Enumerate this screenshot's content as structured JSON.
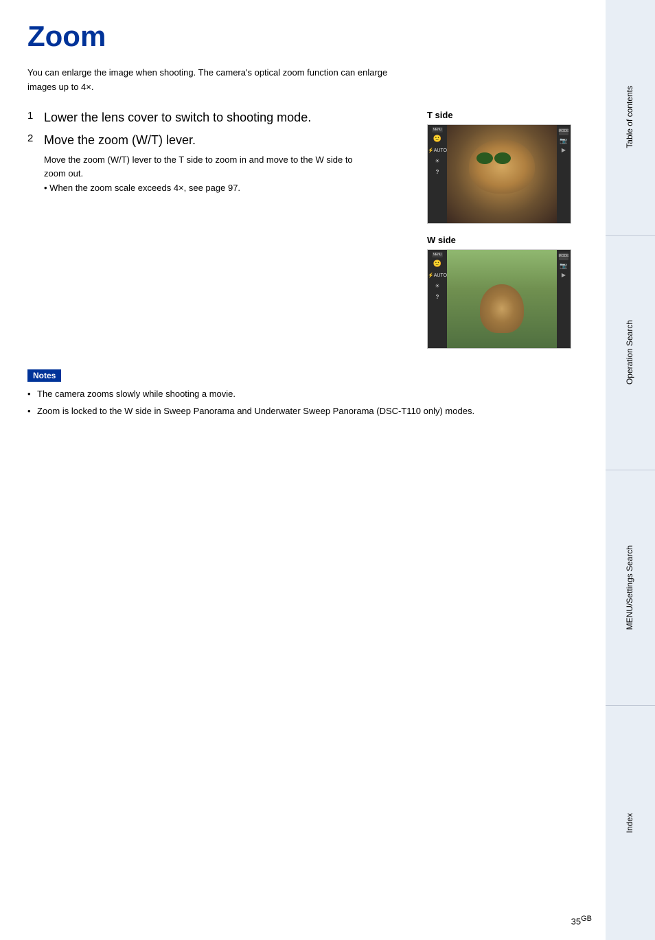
{
  "page": {
    "title": "Zoom",
    "intro": "You can enlarge the image when shooting. The camera's optical zoom function can enlarge images up to 4×.",
    "steps": [
      {
        "number": "1",
        "text": "Lower the lens cover to switch to shooting mode."
      },
      {
        "number": "2",
        "text": "Move the zoom (W/T) lever.",
        "description": "Move the zoom (W/T) lever to the T side to zoom in and move to the W side to zoom out.",
        "bullet": "When the zoom scale exceeds 4×, see page 97."
      }
    ],
    "t_side_label": "T side",
    "w_side_label": "W side",
    "notes_label": "Notes",
    "notes": [
      "The camera zooms slowly while shooting a movie.",
      "Zoom is locked to the W side in Sweep Panorama and Underwater Sweep Panorama (DSC-T110 only) modes."
    ],
    "page_number": "35",
    "page_suffix": "GB"
  },
  "sidebar": {
    "tabs": [
      {
        "id": "table-of-contents",
        "label": "Table of contents"
      },
      {
        "id": "operation-search",
        "label": "Operation Search"
      },
      {
        "id": "menu-settings-search",
        "label": "MENU/Settings Search"
      },
      {
        "id": "index",
        "label": "Index"
      }
    ]
  }
}
